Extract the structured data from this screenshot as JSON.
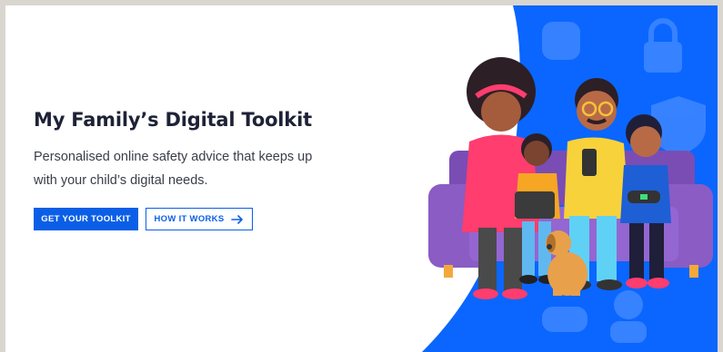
{
  "hero": {
    "title": "My Family’s Digital Toolkit",
    "subtitle": "Personalised online safety advice that keeps up with your child’s digital needs."
  },
  "buttons": {
    "primary_label": "GET YOUR TOOLKIT",
    "secondary_label": "HOW IT WORKS",
    "secondary_icon": "arrow-right-icon"
  },
  "colors": {
    "accent_blue": "#0b5fe6",
    "title_text": "#1e2236",
    "illustration_bg": "#0a66ff",
    "sofa": "#8a5cc4"
  },
  "illustration": {
    "subject": "family-on-sofa",
    "background_icons": [
      "plus-icon",
      "lock-icon",
      "shield-icon",
      "user-icon",
      "gamepad-icon"
    ]
  }
}
